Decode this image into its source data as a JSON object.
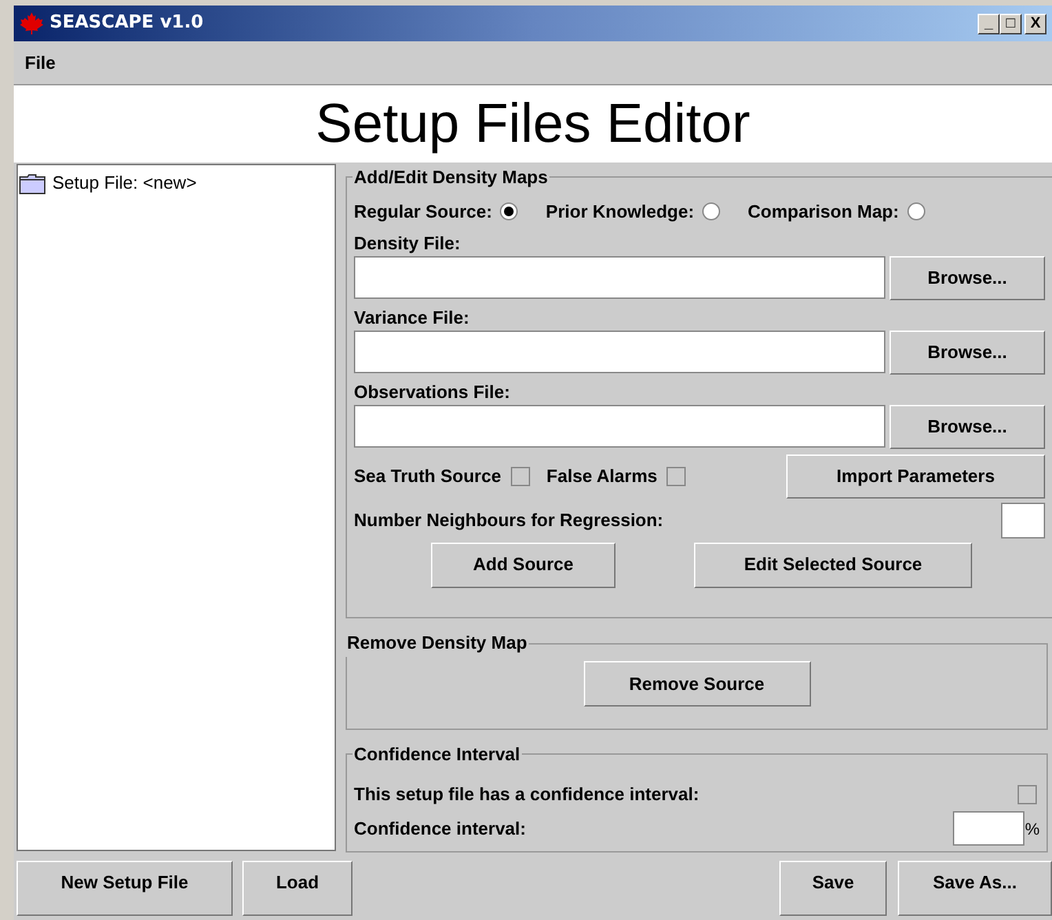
{
  "window": {
    "title": "SEASCAPE v1.0",
    "controls": [
      "_",
      "□",
      "X"
    ]
  },
  "menu": [
    {
      "label": "File"
    }
  ],
  "heading": "Setup Files Editor",
  "tree": [
    {
      "label": "Setup File: <new>"
    }
  ],
  "density": {
    "title": "Add/Edit Density Maps",
    "radios": [
      {
        "label": "Regular Source:",
        "selected": true
      },
      {
        "label": "Prior Knowledge:",
        "selected": false
      },
      {
        "label": "Comparison Map:",
        "selected": false
      }
    ],
    "files": [
      {
        "label": "Density File:",
        "button": "Browse..."
      },
      {
        "label": "Variance File:",
        "button": "Browse..."
      },
      {
        "label": "Observations File:",
        "button": "Browse..."
      }
    ],
    "checks": [
      {
        "label": "Sea Truth Source",
        "checked": false
      },
      {
        "label": "False Alarms",
        "checked": false
      }
    ],
    "import_button": "Import Parameters",
    "neighbours_label": "Number Neighbours for Regression:",
    "buttons": [
      "Add Source",
      "Edit Selected Source"
    ]
  },
  "remove": {
    "title": "Remove Density Map",
    "button": "Remove Source"
  },
  "confidence": {
    "title": "Confidence Interval",
    "check_label": "This setup file has a confidence interval:",
    "checked": false,
    "interval_label": "Confidence interval:",
    "unit": "%"
  },
  "bottom_left": [
    "New Setup File",
    "Load"
  ],
  "bottom_right": [
    "Save",
    "Save As..."
  ]
}
